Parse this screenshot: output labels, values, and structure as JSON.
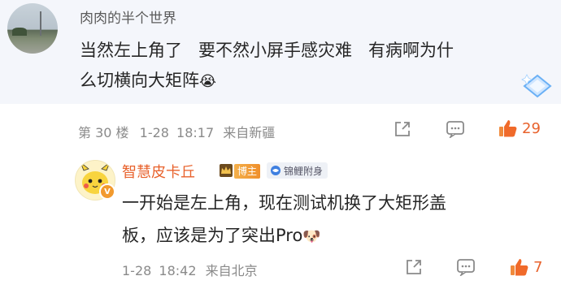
{
  "quote": {
    "username": "肉肉的半个世界",
    "text_line1": "当然左上角了   要不然小屏手感灾难   有病啊为什",
    "text_line2": "么切横向大矩阵",
    "emoji": "😭"
  },
  "floor_meta": {
    "floor": "第 30 楼",
    "date": "1-28",
    "time": "18:17",
    "location": "来自新疆",
    "like_count": "29"
  },
  "reply": {
    "username": "智慧皮卡丘",
    "badge_bozhu": "博主",
    "badge_koi": "锦鲤附身",
    "text_line1": "一开始是左上角，现在测试机换了大矩形盖",
    "text_line2": "板，应该是为了突出Pro",
    "emoji": "🐶",
    "date": "1-28",
    "time": "18:42",
    "location": "来自北京",
    "like_count": "7"
  },
  "colors": {
    "accent_orange": "#e8622c",
    "meta_gray": "#8a8a8a",
    "card_bg": "#f4f6fb"
  },
  "icons": [
    "share-icon",
    "comment-icon",
    "like-icon",
    "crown-icon",
    "diamond-icon",
    "koi-icon"
  ]
}
